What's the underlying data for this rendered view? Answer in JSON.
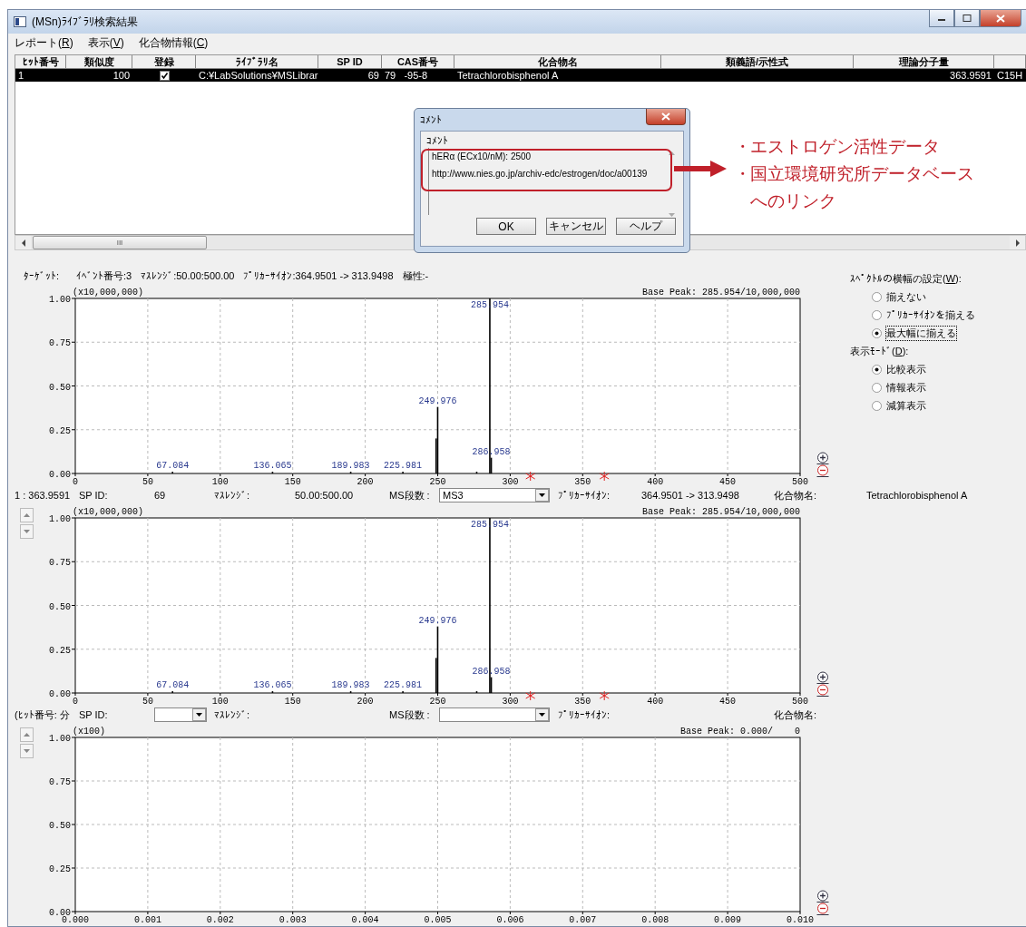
{
  "window": {
    "title": "(MSn)ﾗｲﾌﾞﾗﾘ検索結果"
  },
  "menu": [
    {
      "text": "レポート(",
      "accel": "R",
      "after": ")"
    },
    {
      "text": "表示(",
      "accel": "V",
      "after": ")"
    },
    {
      "text": "化合物情報(",
      "accel": "C",
      "after": ")"
    }
  ],
  "table": {
    "columns": [
      "ﾋｯﾄ番号",
      "類似度",
      "登録",
      "ﾗｲﾌﾞﾗﾘ名",
      "SP ID",
      "CAS番号",
      "化合物名",
      "類義語/示性式",
      "理論分子量"
    ],
    "rows": [
      {
        "selected": true,
        "hit_no": "1",
        "similarity": "100",
        "registered": true,
        "library": "C:¥LabSolutions¥MSLibrar",
        "sp_id": "69",
        "cas": "79   -95-8",
        "compound": "Tetrachlorobisphenol A",
        "mw": "363.9591",
        "column_10": "C15H"
      }
    ]
  },
  "scrollbar_grip": "III",
  "comment_dialog": {
    "title": "ｺﾒﾝﾄ",
    "group": "ｺﾒﾝﾄ",
    "lines": [
      "hERα (ECx10/nM): 2500",
      "http://www.nies.go.jp/archiv-edc/estrogen/doc/a00139"
    ],
    "buttons": [
      "OK",
      "キャンセル",
      "ヘルプ"
    ]
  },
  "callout": {
    "items": [
      {
        "bullet": "・",
        "lines": [
          "エストロゲン活性データ"
        ]
      },
      {
        "bullet": "・",
        "lines": [
          "国立環境研究所データベース",
          "へのリンク"
        ]
      }
    ]
  },
  "spectra": [
    {
      "kind": "target",
      "header": [
        "ﾀｰｹﾞｯﾄ:",
        "ｲﾍﾞﾝﾄ番号:3",
        "ﾏｽﾚﾝｼﾞ:50.00:500.00",
        "ﾌﾟﾘｶｰｻｲｵﾝ:364.9501 -> 313.9498",
        "極性:-"
      ],
      "base_peak": "Base Peak: 285.954/10,000,000",
      "chart_data": {
        "type": "bar",
        "grid": true,
        "ylabel": "(x10,000,000)",
        "x": [
          67.084,
          136.065,
          189.983,
          225.981,
          248.9,
          249.976,
          276.9,
          285.954,
          286.958
        ],
        "values": [
          0.01,
          0.01,
          0.01,
          0.01,
          0.2,
          0.38,
          0.01,
          1.0,
          0.09
        ],
        "xlim": [
          0,
          500
        ],
        "ylim": [
          0,
          1
        ],
        "xticks": [
          0,
          50,
          100,
          150,
          200,
          250,
          300,
          350,
          400,
          450,
          500
        ],
        "yticks": [
          {
            "value": 0,
            "label": "0.00"
          },
          {
            "value": 0.25,
            "label": "0.25"
          },
          {
            "value": 0.5,
            "label": "0.50"
          },
          {
            "value": 0.75,
            "label": "0.75"
          },
          {
            "value": 1,
            "label": "1.00"
          }
        ],
        "annotations": [
          {
            "x": 67.084,
            "y": 0.01,
            "text": "67.084"
          },
          {
            "x": 136.065,
            "y": 0.01,
            "text": "136.065"
          },
          {
            "x": 189.983,
            "y": 0.01,
            "text": "189.983"
          },
          {
            "x": 225.981,
            "y": 0.01,
            "text": "225.981"
          },
          {
            "x": 249.976,
            "y": 0.38,
            "text": "249.976"
          },
          {
            "x": 285.954,
            "y": 1.0,
            "text": "285.954"
          },
          {
            "x": 286.958,
            "y": 0.09,
            "text": "286.958"
          }
        ]
      }
    },
    {
      "kind": "hit",
      "header": {
        "hit": "1 : 363.9591",
        "sp_id_label": "SP ID:",
        "sp_id": {
          "kind": "text",
          "text": "69"
        },
        "mass_range_label": "ﾏｽﾚﾝｼﾞ:",
        "mass_range": "50.00:500.00",
        "ms_stage_label": "MS段数 :",
        "ms_stage": {
          "kind": "dropdown",
          "value": "MS3"
        },
        "precursor_label": "ﾌﾟﾘｶｰｻｲｵﾝ:",
        "precursor": "364.9501 -> 313.9498",
        "compound_label": "化合物名:",
        "compound": "Tetrachlorobisphenol A"
      },
      "base_peak": "Base Peak: 285.954/10,000,000",
      "chart_data": {
        "type": "bar",
        "grid": true,
        "ylabel": "(x10,000,000)",
        "x": [
          67.084,
          136.065,
          189.983,
          225.981,
          248.9,
          249.976,
          276.9,
          285.954,
          286.958
        ],
        "values": [
          0.01,
          0.01,
          0.01,
          0.01,
          0.2,
          0.38,
          0.01,
          1.0,
          0.09
        ],
        "xlim": [
          0,
          500
        ],
        "ylim": [
          0,
          1
        ],
        "xticks": [
          0,
          50,
          100,
          150,
          200,
          250,
          300,
          350,
          400,
          450,
          500
        ],
        "yticks": [
          {
            "value": 0,
            "label": "0.00"
          },
          {
            "value": 0.25,
            "label": "0.25"
          },
          {
            "value": 0.5,
            "label": "0.50"
          },
          {
            "value": 0.75,
            "label": "0.75"
          },
          {
            "value": 1,
            "label": "1.00"
          }
        ],
        "annotations": [
          {
            "x": 67.084,
            "y": 0.01,
            "text": "67.084"
          },
          {
            "x": 136.065,
            "y": 0.01,
            "text": "136.065"
          },
          {
            "x": 189.983,
            "y": 0.01,
            "text": "189.983"
          },
          {
            "x": 225.981,
            "y": 0.01,
            "text": "225.981"
          },
          {
            "x": 249.976,
            "y": 0.38,
            "text": "249.976"
          },
          {
            "x": 285.954,
            "y": 1.0,
            "text": "285.954"
          },
          {
            "x": 286.958,
            "y": 0.09,
            "text": "286.958"
          }
        ]
      }
    },
    {
      "kind": "hit",
      "header": {
        "hit": "(ﾋｯﾄ番号: 分",
        "sp_id_label": "SP ID:",
        "sp_id": {
          "kind": "dropdown"
        },
        "mass_range_label": "ﾏｽﾚﾝｼﾞ:",
        "ms_stage_label": "MS段数 :",
        "ms_stage": {
          "kind": "dropdown"
        },
        "precursor_label": "ﾌﾟﾘｶｰｻｲｵﾝ:",
        "compound_label": "化合物名:"
      },
      "base_peak": "Base Peak: 0.000/    0",
      "chart_data": {
        "type": "bar",
        "grid": true,
        "ylabel": "(x100)",
        "xlim": [
          0,
          0.01
        ],
        "ylim": [
          0,
          1
        ],
        "xticks": [
          {
            "value": 0,
            "label": "0.000"
          },
          {
            "value": 0.001,
            "label": "0.001"
          },
          {
            "value": 0.002,
            "label": "0.002"
          },
          {
            "value": 0.003,
            "label": "0.003"
          },
          {
            "value": 0.004,
            "label": "0.004"
          },
          {
            "value": 0.005,
            "label": "0.005"
          },
          {
            "value": 0.006,
            "label": "0.006"
          },
          {
            "value": 0.007,
            "label": "0.007"
          },
          {
            "value": 0.008,
            "label": "0.008"
          },
          {
            "value": 0.009,
            "label": "0.009"
          },
          {
            "value": 0.01,
            "label": "0.010"
          }
        ],
        "yticks": [
          {
            "value": 0,
            "label": "0.00"
          },
          {
            "value": 0.25,
            "label": "0.25"
          },
          {
            "value": 0.5,
            "label": "0.50"
          },
          {
            "value": 0.75,
            "label": "0.75"
          },
          {
            "value": 1,
            "label": "1.00"
          }
        ]
      }
    }
  ],
  "options": [
    {
      "title": {
        "text": "ｽﾍﾟｸﾄﾙの横幅の設定(",
        "accel": "W",
        "after": "):"
      },
      "items": [
        {
          "label": "揃えない",
          "selected": false,
          "focused": false
        },
        {
          "label": "ﾌﾟﾘｶｰｻｲｵﾝを揃える",
          "selected": false,
          "focused": false
        },
        {
          "label": "最大幅に揃える",
          "selected": true,
          "focused": true
        }
      ]
    },
    {
      "title": {
        "text": "表示ﾓｰﾄﾞ(",
        "accel": "D",
        "after": "):"
      },
      "items": [
        {
          "label": "比較表示",
          "selected": true,
          "focused": false
        },
        {
          "label": "情報表示",
          "selected": false,
          "focused": false
        },
        {
          "label": "減算表示",
          "selected": false,
          "focused": false
        }
      ]
    }
  ]
}
